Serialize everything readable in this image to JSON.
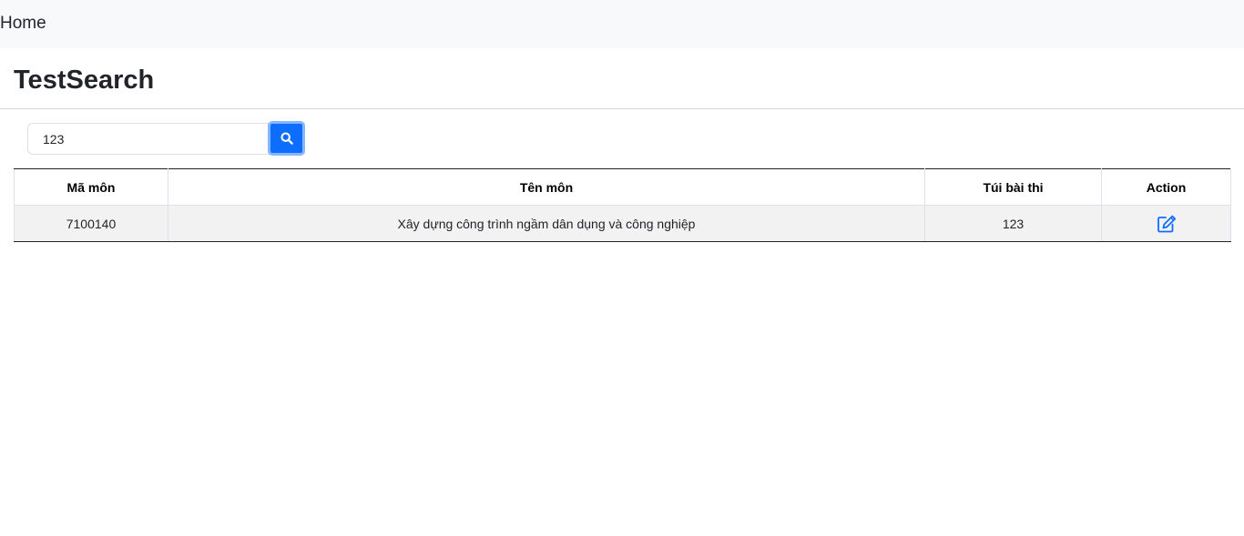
{
  "navbar": {
    "home_label": "Home"
  },
  "page": {
    "title": "TestSearch"
  },
  "search": {
    "value": "123",
    "button_icon": "search-icon"
  },
  "table": {
    "headers": [
      "Mã môn",
      "Tên môn",
      "Túi bài thi",
      "Action"
    ],
    "rows": [
      {
        "ma_mon": "7100140",
        "ten_mon": "Xây dựng công trình ngầm dân dụng và công nghiệp",
        "tui_bai_thi": "123",
        "action_icon": "edit-icon"
      }
    ]
  },
  "colors": {
    "primary": "#0d6efd",
    "focus_ring": "#86b7fe",
    "navbar_bg": "#f8f9fa",
    "row_bg": "#f2f2f2"
  }
}
